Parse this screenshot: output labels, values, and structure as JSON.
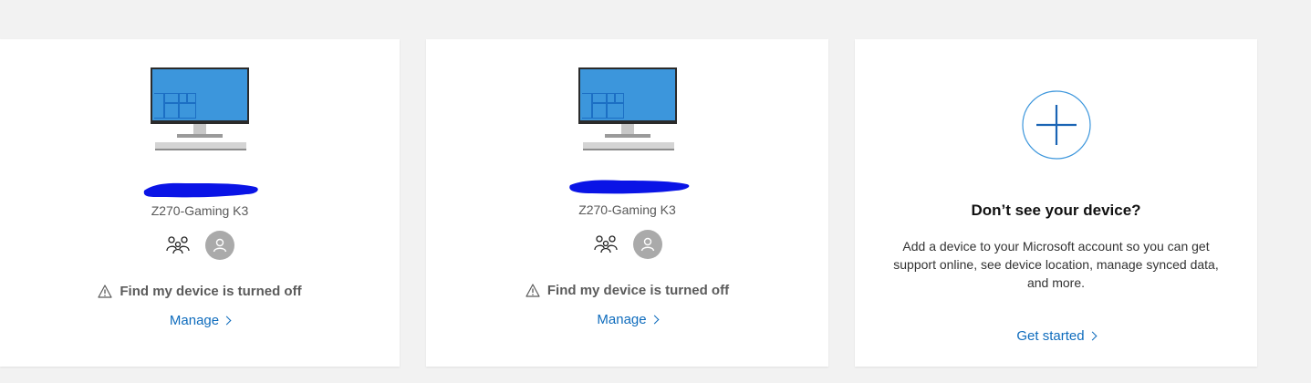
{
  "devices": [
    {
      "model": "Z270-Gaming K3",
      "status_text": "Find my device is turned off",
      "manage_label": "Manage"
    },
    {
      "model": "Z270-Gaming K3",
      "status_text": "Find my device is turned off",
      "manage_label": "Manage"
    }
  ],
  "add_device": {
    "title": "Don’t see your device?",
    "description": "Add a device to your Microsoft account so you can get support online, see device location, manage synced data, and more.",
    "cta_label": "Get started"
  },
  "colors": {
    "link": "#0f6cbd",
    "screen_blue": "#3c96dc",
    "redaction": "#0a14e6",
    "background": "#f2f2f2"
  },
  "icons": [
    "desktop-pc-icon",
    "family-icon",
    "user-avatar-icon",
    "warning-icon",
    "chevron-right-icon",
    "add-circle-icon"
  ]
}
